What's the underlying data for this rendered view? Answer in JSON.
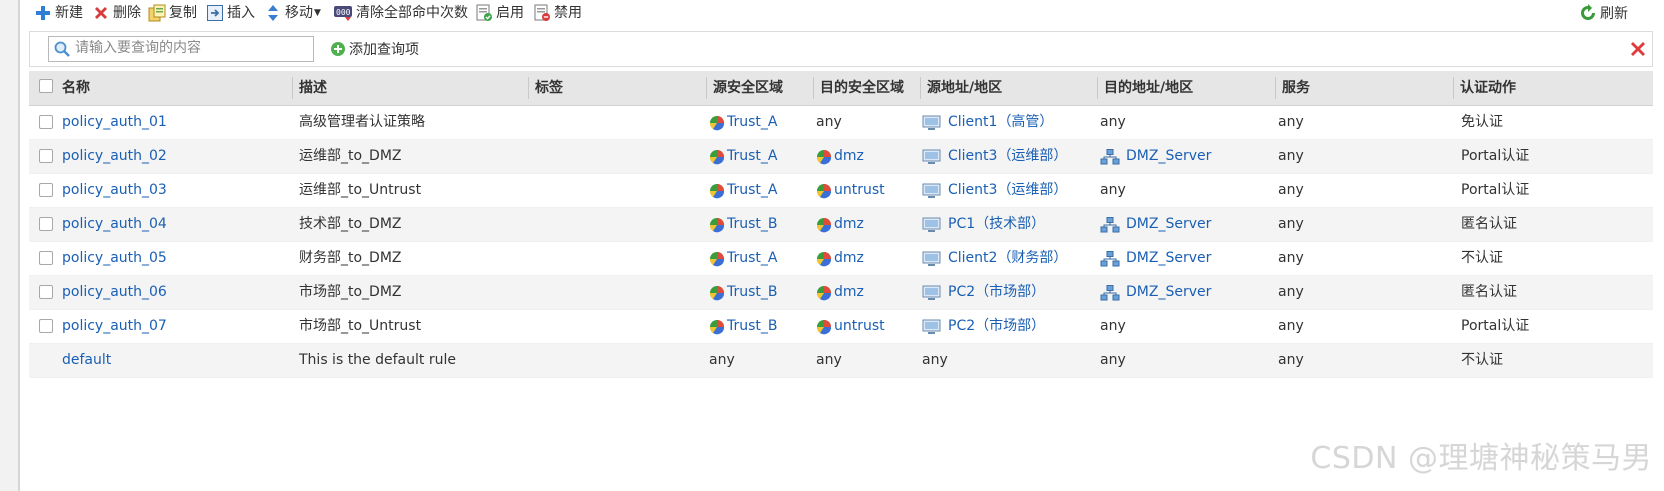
{
  "toolbar": {
    "new_label": "新建",
    "delete_label": "删除",
    "copy_label": "复制",
    "insert_label": "插入",
    "move_label": "移动",
    "clear_hits_label": "清除全部命中次数",
    "enable_label": "启用",
    "disable_label": "禁用",
    "refresh_label": "刷新"
  },
  "search": {
    "placeholder": "请输入要查询的内容",
    "value": "",
    "add_query_label": "添加查询项"
  },
  "columns": [
    "名称",
    "描述",
    "标签",
    "源安全区域",
    "目的安全区域",
    "源地址/地区",
    "目的地址/地区",
    "服务",
    "认证动作"
  ],
  "rows": [
    {
      "name": "policy_auth_01",
      "desc": "高级管理者认证策略",
      "tag": "",
      "src_zone": "Trust_A",
      "dst_zone": "any",
      "src_addr": "Client1（高管）",
      "dst_addr": "any",
      "service": "any",
      "action": "免认证",
      "checkbox": true
    },
    {
      "name": "policy_auth_02",
      "desc": "运维部_to_DMZ",
      "tag": "",
      "src_zone": "Trust_A",
      "dst_zone": "dmz",
      "src_addr": "Client3（运维部）",
      "dst_addr": "DMZ_Server",
      "service": "any",
      "action": "Portal认证",
      "checkbox": true
    },
    {
      "name": "policy_auth_03",
      "desc": "运维部_to_Untrust",
      "tag": "",
      "src_zone": "Trust_A",
      "dst_zone": "untrust",
      "src_addr": "Client3（运维部）",
      "dst_addr": "any",
      "service": "any",
      "action": "Portal认证",
      "checkbox": true
    },
    {
      "name": "policy_auth_04",
      "desc": "技术部_to_DMZ",
      "tag": "",
      "src_zone": "Trust_B",
      "dst_zone": "dmz",
      "src_addr": "PC1（技术部）",
      "dst_addr": "DMZ_Server",
      "service": "any",
      "action": "匿名认证",
      "checkbox": true
    },
    {
      "name": "policy_auth_05",
      "desc": "财务部_to_DMZ",
      "tag": "",
      "src_zone": "Trust_A",
      "dst_zone": "dmz",
      "src_addr": "Client2（财务部）",
      "dst_addr": "DMZ_Server",
      "service": "any",
      "action": "不认证",
      "checkbox": true
    },
    {
      "name": "policy_auth_06",
      "desc": "市场部_to_DMZ",
      "tag": "",
      "src_zone": "Trust_B",
      "dst_zone": "dmz",
      "src_addr": "PC2（市场部）",
      "dst_addr": "DMZ_Server",
      "service": "any",
      "action": "匿名认证",
      "checkbox": true
    },
    {
      "name": "policy_auth_07",
      "desc": "市场部_to_Untrust",
      "tag": "",
      "src_zone": "Trust_B",
      "dst_zone": "untrust",
      "src_addr": "PC2（市场部）",
      "dst_addr": "any",
      "service": "any",
      "action": "Portal认证",
      "checkbox": true
    },
    {
      "name": "default",
      "desc": "This is the default rule",
      "tag": "",
      "src_zone": "any",
      "dst_zone": "any",
      "src_addr": "any",
      "dst_addr": "any",
      "service": "any",
      "action": "不认证",
      "checkbox": false
    }
  ],
  "colors": {
    "link": "#1a5fb4",
    "header_bg": "#e6e6e6",
    "row_alt_bg": "#f4f4f4",
    "close_red": "#e03a3a"
  },
  "watermark": "CSDN @理塘神秘策马男"
}
